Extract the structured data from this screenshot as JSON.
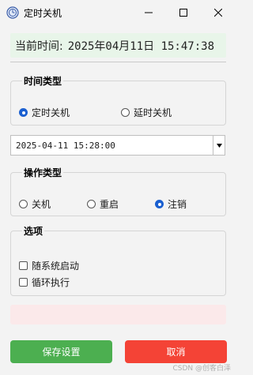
{
  "window": {
    "title": "定时关机",
    "icon": "app-icon",
    "controls": [
      "minimize-icon",
      "maximize-icon",
      "close-icon"
    ]
  },
  "clock": {
    "label": "当前时间:",
    "value": "2025年04月11日 15:47:38"
  },
  "time_type": {
    "title": "时间类型",
    "options": [
      {
        "label": "定时关机",
        "checked": true
      },
      {
        "label": "延时关机",
        "checked": false
      }
    ]
  },
  "datetime": {
    "value": "2025-04-11 15:28:00"
  },
  "op_type": {
    "title": "操作类型",
    "options": [
      {
        "label": "关机",
        "checked": false
      },
      {
        "label": "重启",
        "checked": false
      },
      {
        "label": "注销",
        "checked": true
      }
    ]
  },
  "options": {
    "title": "选项",
    "items": [
      {
        "label": "随系统启动",
        "checked": false
      },
      {
        "label": "循环执行",
        "checked": false
      }
    ]
  },
  "buttons": {
    "save": "保存设置",
    "cancel": "取消"
  },
  "watermark": "CSDN @创客白泽",
  "colors": {
    "save": "#4caf50",
    "cancel": "#f44336",
    "clock_bg": "#e8f5e9",
    "status_bg": "#fbe9ea",
    "radio_accent": "#1a5fd0"
  }
}
